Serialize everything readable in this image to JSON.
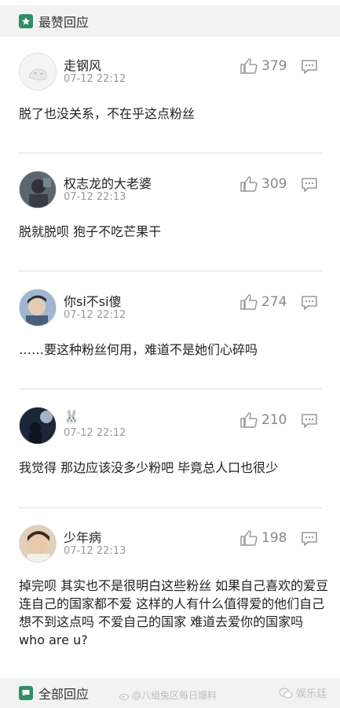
{
  "top_section": {
    "title": "最赞回应",
    "icon": "star-icon"
  },
  "bottom_section": {
    "title": "全部回应",
    "icon": "chat-bubble-icon"
  },
  "comments": [
    {
      "username": "走钢风",
      "time": "07-12 22:12",
      "likes": "379",
      "text": "脱了也没关系，不在乎这点粉丝"
    },
    {
      "username": "权志龙的大老婆",
      "time": "07-12 22:13",
      "likes": "309",
      "text": "脱就脱呗 狍子不吃芒果干"
    },
    {
      "username": "你si不si傻",
      "time": "07-12 22:12",
      "likes": "274",
      "text": "……要这种粉丝何用，难道不是她们心碎吗"
    },
    {
      "username": "🐰",
      "time": "07-12 22:12",
      "likes": "210",
      "text": "我觉得  那边应该没多少粉吧   毕竟总人口也很少"
    },
    {
      "username": "少年病",
      "time": "07-12 22:13",
      "likes": "198",
      "text": "掉完呗 其实也不是很明白这些粉丝 如果自己喜欢的爱豆连自己的国家都不爱 这样的人有什么值得爱的他们自己想不到这点吗 不爱自己的国家 难道去爱你的国家吗 who are u?"
    }
  ],
  "watermarks": {
    "weibo": "@八组兔区每日爆料",
    "wechat": "娱乐廷"
  },
  "colors": {
    "accent": "#2e8f6a",
    "header_bg": "#f2f2f2",
    "muted": "#9a9a9a"
  }
}
